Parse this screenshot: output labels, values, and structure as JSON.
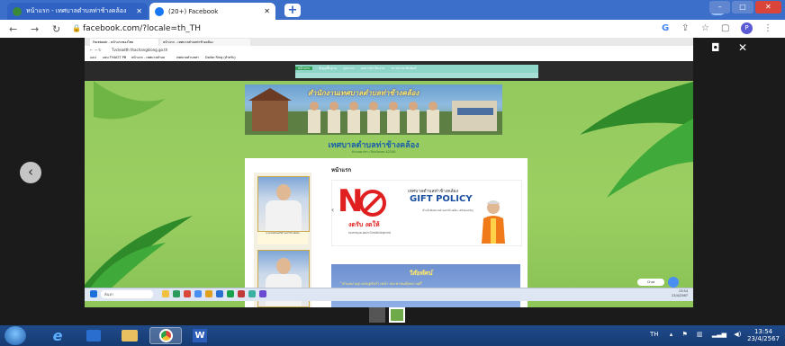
{
  "outer_tabs": [
    {
      "label": "หน้าแรก - เทศบาลตำบลท่าช้างคล้อง"
    },
    {
      "label": "(20+) Facebook"
    }
  ],
  "new_tab_icon": "+",
  "outer_url": "facebook.com/?locale=th_TH",
  "outer_profile_initial": "P",
  "inner_browser": {
    "tabs": [
      "Facebook - หน้าแรกของไทย",
      "หน้าแรก - เทศบาลตำบลท่าช้างคล้อง"
    ],
    "url": "Tvcleadth   thachangklong.go.th",
    "bookmarks": [
      "แอป",
      "แผ่น THACIT PB",
      "หน้าแรก - เทศบาลตำบล",
      "เทศบาลตำบลท่า",
      "Dollar Ring (สำหรับ)"
    ],
    "site_menu_home": "หน้าแรก",
    "site_menu_items": [
      "ข้อมูลพื้นฐาน",
      "บุคลากร",
      "ผลการดำเนินงาน",
      "ข่าวประชาสัมพันธ์"
    ],
    "banner_title": "สำนักงานเทศบาลตำบลท่าช้างคล้อง",
    "site_name": "เทศบาลตำบลท่าช้างคล้อง",
    "site_sub": "อำเภอผาขาว จังหวัดเลย 42240",
    "page_heading": "หน้าแรก",
    "mayor_caption": "นายกเทศมนตรีตำบลท่าช้างคล้อง",
    "slide": {
      "no": "N",
      "org_small": "เทศบาลตำบลท่าช้างคล้อง",
      "title": "GIFT POLICY",
      "red_text": "งดรับ งดให้",
      "note": "ของขวัญและผลประโยชน์อื่นใดทุกกรณี",
      "side_text": "เจ้าหน้าที่เทศบาลตำบลท่าช้างคล้อง งดรับของขวัญ"
    },
    "vision": {
      "title": "วิสัยทัศน์",
      "text": "\"ตำบลน่าอยู่ เศรษฐกิจก้าวหน้า ประชาชนมีสุขภาพดี\""
    },
    "chat_label": "Chat",
    "taskbar_search": "ค้นหา",
    "clock": [
      "13:54",
      "23/4/2567"
    ]
  },
  "outer_taskbar": {
    "tray_lang": "TH",
    "time": "13:54",
    "date": "23/4/2567"
  },
  "colors": {
    "outer_chrome": "#3b6fc9",
    "site_green": "#93c95e",
    "gift_red": "#e02020",
    "gift_blue": "#1a4fa0",
    "taskbar": "#1f4a8a"
  }
}
